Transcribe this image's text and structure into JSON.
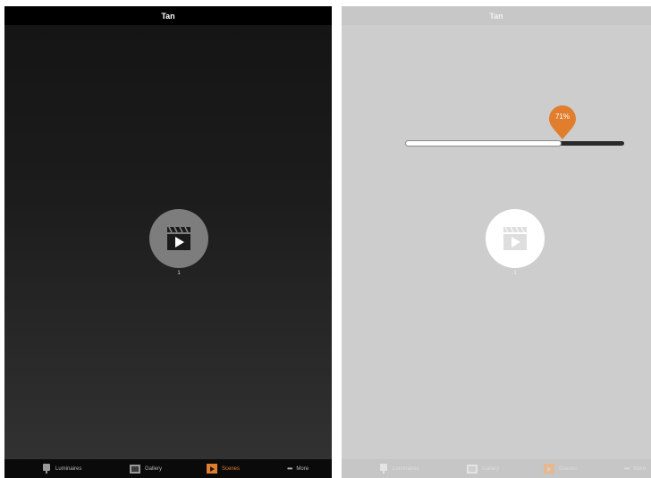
{
  "colors": {
    "accent": "#e07e2e",
    "dark_background": "#1c1c1c",
    "light_background": "#cdcdcd"
  },
  "dark_screen": {
    "title": "Tan",
    "scene": {
      "label": "1",
      "icon": "clapperboard-icon"
    },
    "tabs": [
      {
        "label": "Luminaires",
        "icon": "lamp-icon",
        "active": false
      },
      {
        "label": "Gallery",
        "icon": "gallery-icon",
        "active": false
      },
      {
        "label": "Scenes",
        "icon": "clapperboard-icon",
        "active": true
      },
      {
        "label": "More",
        "icon": "more-icon",
        "active": false
      }
    ]
  },
  "light_screen": {
    "title": "Tan",
    "brightness": {
      "value_text": "71%",
      "value": 0.71
    },
    "scene": {
      "label": "1",
      "icon": "clapperboard-icon"
    },
    "tabs": [
      {
        "label": "Luminaires",
        "icon": "lamp-icon"
      },
      {
        "label": "Gallery",
        "icon": "gallery-icon"
      },
      {
        "label": "Scenes",
        "icon": "clapperboard-icon"
      },
      {
        "label": "More",
        "icon": "more-icon"
      }
    ]
  }
}
